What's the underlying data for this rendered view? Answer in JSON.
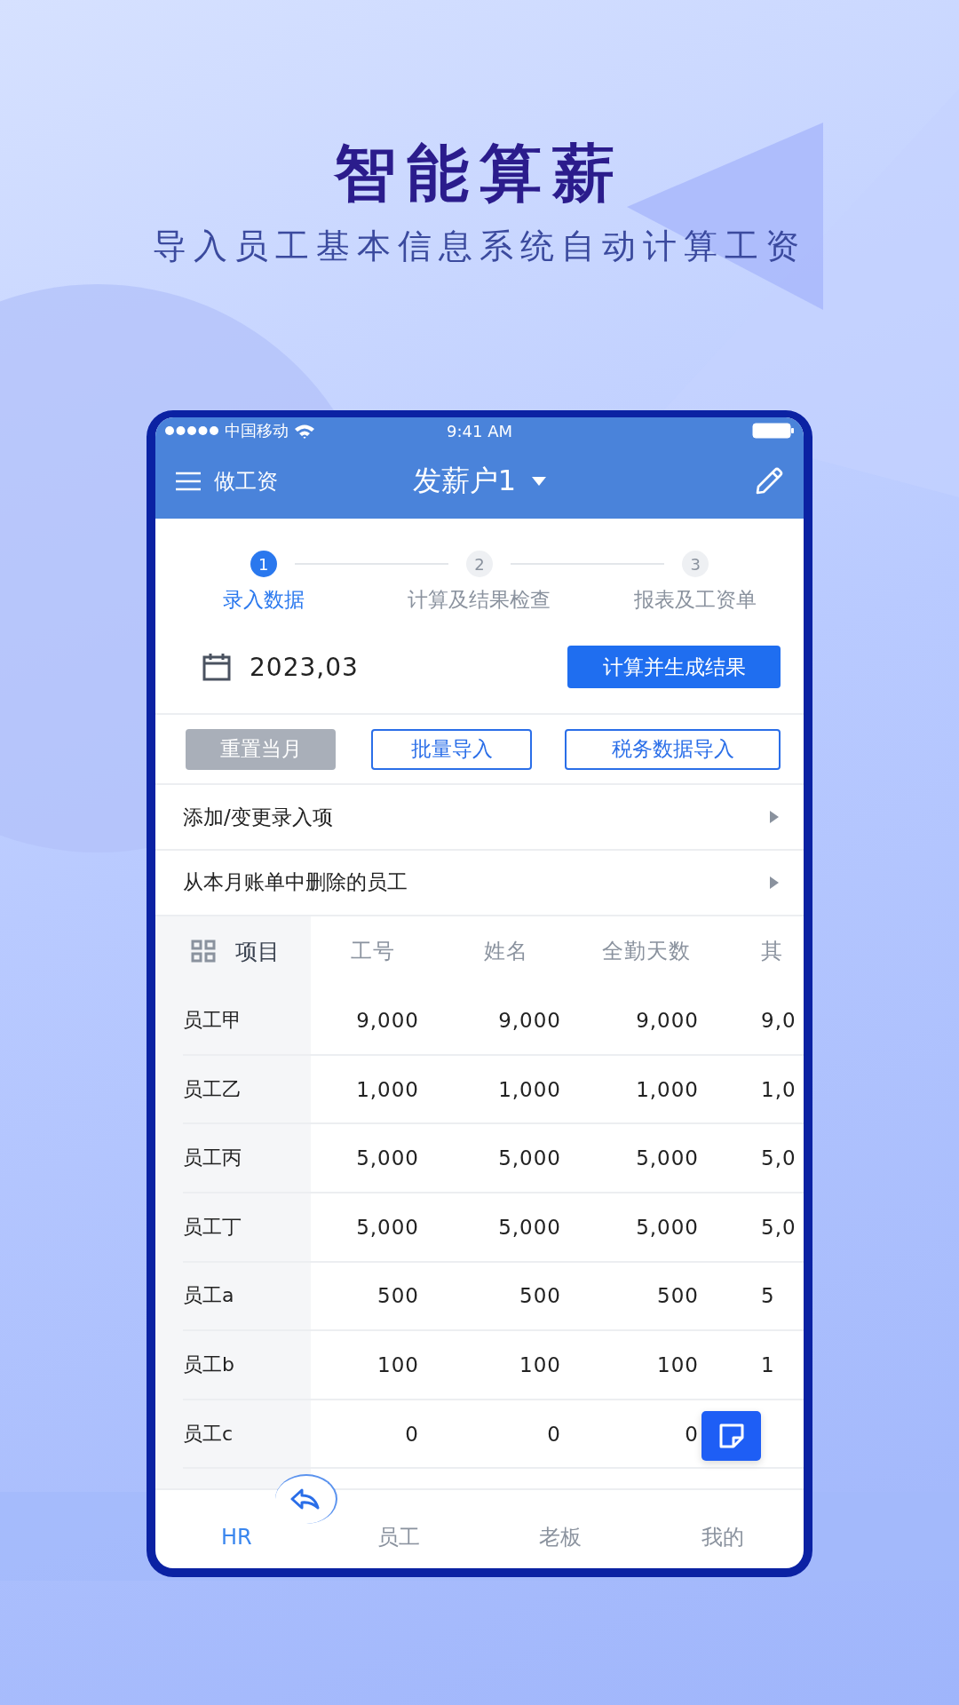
{
  "headline": {
    "title": "智能算薪",
    "subtitle": "导入员工基本信息系统自动计算工资"
  },
  "status_bar": {
    "carrier": "中国移动",
    "time": "9:41 AM"
  },
  "app_bar": {
    "menu_label": "做工资",
    "title": "发薪户1"
  },
  "steps": [
    {
      "number": "1",
      "label": "录入数据",
      "selected": true
    },
    {
      "number": "2",
      "label": "计算及结果检查",
      "selected": false
    },
    {
      "number": "3",
      "label": "报表及工资单",
      "selected": false
    }
  ],
  "period": {
    "date": "2023,03",
    "action": "计算并生成结果"
  },
  "buttons": [
    {
      "label": "重置当月",
      "disabled": true
    },
    {
      "label": "批量导入",
      "disabled": false
    },
    {
      "label": "税务数据导入",
      "disabled": false
    }
  ],
  "menu_items": [
    {
      "label": "添加/变更录入项"
    },
    {
      "label": "从本月账单中删除的员工"
    }
  ],
  "table": {
    "columns": [
      "项目",
      "工号",
      "姓名",
      "全勤天数",
      "其"
    ],
    "rows": [
      {
        "cells": [
          "员工甲",
          "9,000",
          "9,000",
          "9,000",
          "9,0"
        ]
      },
      {
        "cells": [
          "员工乙",
          "1,000",
          "1,000",
          "1,000",
          "1,0"
        ]
      },
      {
        "cells": [
          "员工丙",
          "5,000",
          "5,000",
          "5,000",
          "5,0"
        ]
      },
      {
        "cells": [
          "员工丁",
          "5,000",
          "5,000",
          "5,000",
          "5,0"
        ]
      },
      {
        "cells": [
          "员工a",
          "500",
          "500",
          "500",
          "5"
        ]
      },
      {
        "cells": [
          "员工b",
          "100",
          "100",
          "100",
          "1"
        ]
      },
      {
        "cells": [
          "员工c",
          "0",
          "0",
          "0"
        ]
      }
    ]
  },
  "nav": [
    {
      "label": "HR",
      "selected": true
    },
    {
      "label": "员工",
      "selected": false
    },
    {
      "label": "老板",
      "selected": false
    },
    {
      "label": "我的",
      "selected": false
    }
  ]
}
